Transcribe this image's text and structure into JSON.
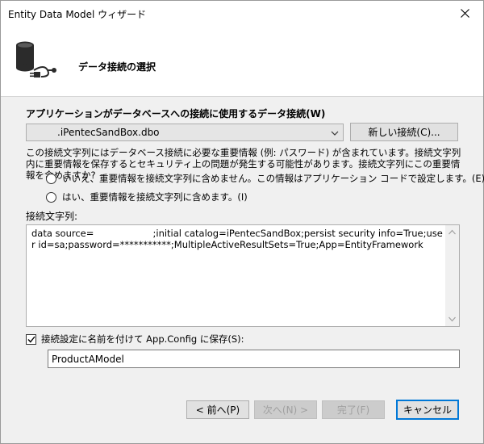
{
  "window": {
    "title": "Entity Data Model ウィザード",
    "close_glyph": "✕"
  },
  "header": {
    "icon": "database-plug-icon",
    "step_title": "データ接続の選択"
  },
  "connection": {
    "label": "アプリケーションがデータベースへの接続に使用するデータ接続(W)",
    "selected": ".iPentecSandBox.dbo",
    "new_connection_button": "新しい接続(C)..."
  },
  "sensitive": {
    "description": "この接続文字列にはデータベース接続に必要な重要情報 (例: パスワード) が含まれています。接続文字列内に重要情報を保存するとセキュリティ上の問題が発生する可能性があります。接続文字列にこの重要情報を含めますか?",
    "option_exclude": "いいえ、重要情報を接続文字列に含めません。この情報はアプリケーション コードで設定します。(E)",
    "option_include": "はい、重要情報を接続文字列に含めます。(I)"
  },
  "connection_string": {
    "label": "接続文字列:",
    "value": "data source=                    ;initial catalog=iPentecSandBox;persist security info=True;user id=sa;password=***********;MultipleActiveResultSets=True;App=EntityFramework"
  },
  "save": {
    "checkbox_label": "接続設定に名前を付けて App.Config に保存(S):",
    "checked": true,
    "name_value": "ProductAModel"
  },
  "buttons": {
    "back": "< 前へ(P)",
    "next": "次へ(N) >",
    "finish": "完了(F)",
    "cancel": "キャンセル"
  },
  "colors": {
    "accent": "#0078d7",
    "window_bg": "#f0f0f0",
    "header_bg": "#ffffff"
  }
}
